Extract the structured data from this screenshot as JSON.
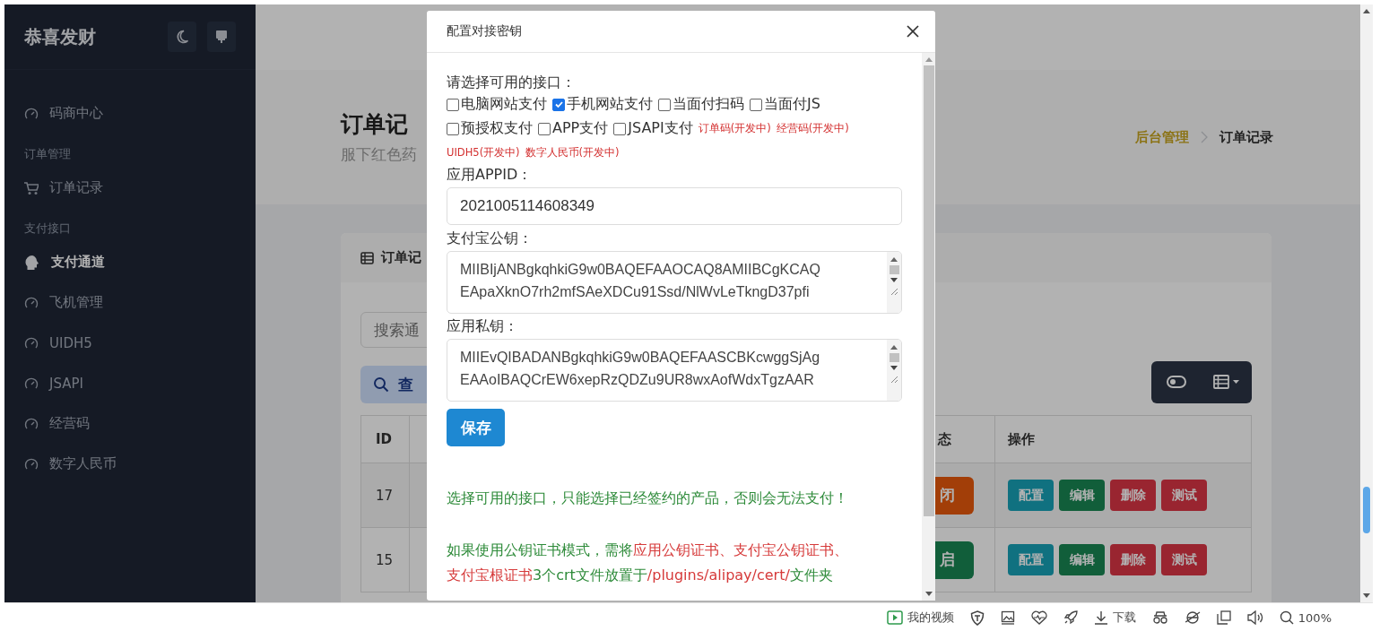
{
  "sidebar": {
    "brand": "恭喜发财",
    "menu": [
      {
        "kind": "gauge",
        "label": "码商中心",
        "selected": false
      },
      {
        "kind": "header",
        "label": "订单管理"
      },
      {
        "kind": "cart",
        "label": "订单记录",
        "selected": false
      },
      {
        "kind": "header",
        "label": "支付接口"
      },
      {
        "kind": "gauge",
        "label": "支付通道",
        "selected": true
      },
      {
        "kind": "gauge",
        "label": "飞机管理",
        "selected": false
      },
      {
        "kind": "gauge",
        "label": "UIDH5",
        "selected": false
      },
      {
        "kind": "gauge",
        "label": "JSAPI",
        "selected": false
      },
      {
        "kind": "gauge",
        "label": "经营码",
        "selected": false
      },
      {
        "kind": "gauge",
        "label": "数字人民币",
        "selected": false
      }
    ]
  },
  "page_header": {
    "title": "订单记",
    "subtitle": "服下红色药",
    "breadcrumb": [
      {
        "label": "后台管理",
        "selected": false
      },
      {
        "label": "订单记录",
        "selected": true
      }
    ]
  },
  "card": {
    "title": "订单记",
    "search": {
      "placeholder": "搜索通"
    },
    "query_button": "查",
    "table": {
      "columns": [
        {
          "label": "ID"
        },
        {
          "label": "态"
        },
        {
          "label": "操作"
        }
      ],
      "rows": [
        {
          "id": "17",
          "status": "闭",
          "status_on": false,
          "actions": [
            {
              "kind": "config",
              "label": "配置"
            },
            {
              "kind": "edit",
              "label": "编辑"
            },
            {
              "kind": "delete",
              "label": "删除"
            },
            {
              "kind": "test",
              "label": "测试"
            }
          ]
        },
        {
          "id": "15",
          "status": "启",
          "status_on": true,
          "actions": [
            {
              "kind": "config",
              "label": "配置"
            },
            {
              "kind": "edit",
              "label": "编辑"
            },
            {
              "kind": "delete",
              "label": "删除"
            },
            {
              "kind": "test",
              "label": "测试"
            }
          ]
        }
      ]
    }
  },
  "modal": {
    "title": "配置对接密钥",
    "interfaces_label": "请选择可用的接口：",
    "interface_rows": [
      [
        {
          "kind": "checkbox",
          "label": "电脑网站支付",
          "checked": false
        },
        {
          "kind": "checkbox",
          "label": "手机网站支付",
          "checked": true
        },
        {
          "kind": "checkbox",
          "label": "当面付扫码",
          "checked": false
        },
        {
          "kind": "checkbox",
          "label": "当面付JS",
          "checked": false
        }
      ],
      [
        {
          "kind": "checkbox",
          "label": "预授权支付",
          "checked": false
        },
        {
          "kind": "checkbox",
          "label": "APP支付",
          "checked": false
        },
        {
          "kind": "checkbox",
          "label": "JSAPI支付",
          "checked": false
        },
        {
          "kind": "note",
          "label": "订单码(开发中)"
        },
        {
          "kind": "note",
          "label": "经营码(开发中)"
        }
      ],
      [
        {
          "kind": "note",
          "label": "UIDH5(开发中)"
        },
        {
          "kind": "note",
          "label": "数字人民币(开发中)"
        }
      ]
    ],
    "fields": [
      {
        "kind": "input",
        "label": "应用APPID：",
        "value": "2021005114608349"
      },
      {
        "kind": "textarea",
        "label": "支付宝公钥：",
        "lines": [
          "MIIBIjANBgkqhkiG9w0BAQEFAAOCAQ8AMIIBCgKCAQ",
          "EApaXknO7rh2mfSAeXDCu91Ssd/NlWvLeTkngD37pfi"
        ]
      },
      {
        "kind": "textarea",
        "label": "应用私钥：",
        "lines": [
          "MIIEvQIBADANBgkqhkiG9w0BAQEFAASCBKcwggSjAg",
          "EAAoIBAQCrEW6xepRzQDZu9UR8wxAofWdxTgzAAR"
        ]
      }
    ],
    "save_button": "保存",
    "notes": [
      {
        "lines": [
          [
            {
              "text": "选择可用的接口，只能选择已经签约的产品，否则会无法支付！",
              "highlight": false
            }
          ]
        ]
      },
      {
        "lines": [
          [
            {
              "text": "如果使用公钥证书模式，需将",
              "highlight": false
            },
            {
              "text": "应用公钥证书、支付宝公钥证书、",
              "highlight": true
            }
          ],
          [
            {
              "text": "支付宝根证书",
              "highlight": true
            },
            {
              "text": "3个crt文件放置于",
              "highlight": false
            },
            {
              "text": "/plugins/alipay/cert/",
              "highlight": true
            },
            {
              "text": "文件夹",
              "highlight": false
            }
          ]
        ]
      }
    ]
  },
  "status_bar": [
    {
      "kind": "video",
      "label": "我的视频"
    },
    {
      "kind": "shield"
    },
    {
      "kind": "image"
    },
    {
      "kind": "heart"
    },
    {
      "kind": "rocket"
    },
    {
      "kind": "download",
      "label": "下载"
    },
    {
      "kind": "glasses"
    },
    {
      "kind": "browser"
    },
    {
      "kind": "window"
    },
    {
      "kind": "sound"
    },
    {
      "kind": "zoom",
      "label": "100%"
    }
  ]
}
